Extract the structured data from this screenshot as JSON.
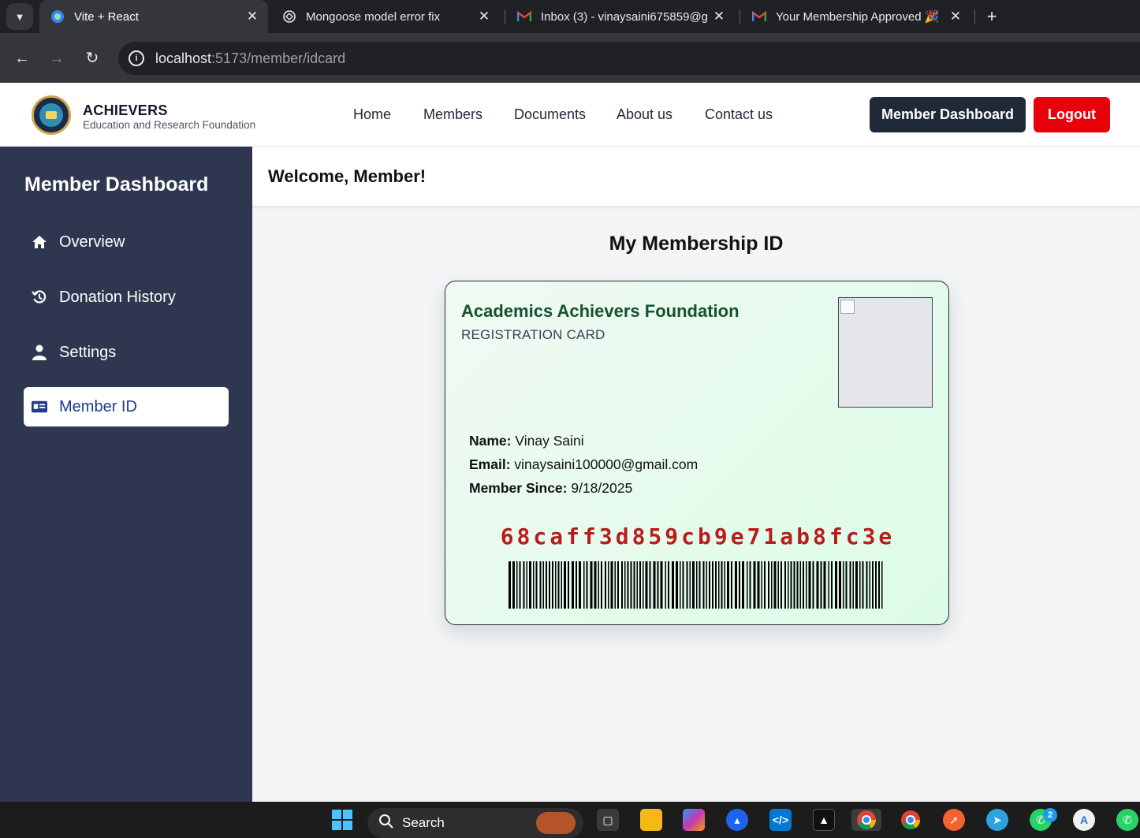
{
  "browser": {
    "tabs": [
      {
        "title": "Vite + React",
        "icon": "vite-icon",
        "active": true
      },
      {
        "title": "Mongoose model error fix",
        "icon": "chatgpt-icon",
        "active": false
      },
      {
        "title": "Inbox (3) - vinaysaini675859@g",
        "icon": "gmail-icon",
        "active": false
      },
      {
        "title": "Your Membership Approved 🎉",
        "icon": "gmail-icon",
        "active": false
      }
    ],
    "url_host": "localhost",
    "url_path": ":5173/member/idcard"
  },
  "header": {
    "brand_name": "ACHIEVERS",
    "brand_sub": "Education and Research Foundation",
    "nav": [
      "Home",
      "Members",
      "Documents",
      "About us",
      "Contact us"
    ],
    "dashboard_button": "Member Dashboard",
    "logout_button": "Logout",
    "colors": {
      "dashboard_bg": "#1f2937",
      "logout_bg": "#e8000b"
    }
  },
  "sidebar": {
    "title": "Member Dashboard",
    "items": [
      {
        "label": "Overview",
        "icon": "home-icon",
        "active": false
      },
      {
        "label": "Donation History",
        "icon": "history-icon",
        "active": false
      },
      {
        "label": "Settings",
        "icon": "user-icon",
        "active": false
      },
      {
        "label": "Member ID",
        "icon": "id-card-icon",
        "active": true
      }
    ],
    "bg_color": "#2f3650"
  },
  "main": {
    "welcome": "Welcome, Member!",
    "section_title": "My Membership ID",
    "card": {
      "org": "Academics Achievers Foundation",
      "subtitle": "REGISTRATION CARD",
      "name_label": "Name:",
      "name_value": "Vinay Saini",
      "email_label": "Email:",
      "email_value": "vinaysaini100000@gmail.com",
      "since_label": "Member Since:",
      "since_value": "9/18/2025",
      "member_id": "68caff3d859cb9e71ab8fc3e",
      "id_color": "#b91c1c",
      "org_color": "#14532d"
    }
  },
  "taskbar": {
    "search_label": "Search",
    "whatsapp_badge": "2"
  }
}
